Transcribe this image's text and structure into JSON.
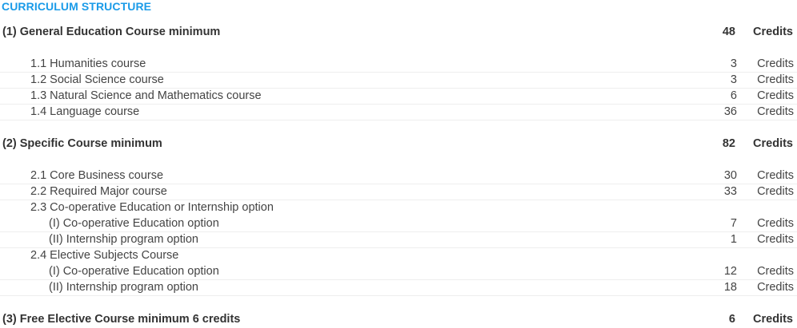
{
  "heading": "CURRICULUM STRUCTURE",
  "sections": [
    {
      "label": "(1) General Education Course  minimum",
      "credits": "48",
      "unit": "Credits",
      "items": [
        {
          "label": "1.1 Humanities course",
          "credits": "3",
          "unit": "Credits"
        },
        {
          "label": "1.2 Social Science course",
          "credits": "3",
          "unit": "Credits"
        },
        {
          "label": "1.3 Natural Science and Mathematics course",
          "credits": "6",
          "unit": "Credits"
        },
        {
          "label": "1.4 Language course",
          "credits": "36",
          "unit": "Credits"
        }
      ]
    },
    {
      "label": "(2)  Specific Course minimum",
      "credits": "82",
      "unit": "Credits",
      "items": [
        {
          "label": "2.1 Core Business course",
          "credits": "30",
          "unit": "Credits"
        },
        {
          "label": "2.2 Required Major course",
          "credits": "33",
          "unit": "Credits"
        },
        {
          "label": "2.3 Co-operative Education or Internship option",
          "credits": "",
          "unit": ""
        },
        {
          "label": "(I) Co-operative Education option",
          "credits": "7",
          "unit": "Credits"
        },
        {
          "label": "(II) Internship program option",
          "credits": "1",
          "unit": "Credits"
        },
        {
          "label": "2.4 Elective Subjects Course",
          "credits": "",
          "unit": ""
        },
        {
          "label": "(I) Co-operative Education option",
          "credits": "12",
          "unit": "Credits"
        },
        {
          "label": "(II) Internship program option",
          "credits": "18",
          "unit": "Credits"
        }
      ]
    },
    {
      "label": "(3) Free Elective Course minimum 6 credits",
      "credits": "6",
      "unit": "Credits",
      "items": []
    }
  ]
}
